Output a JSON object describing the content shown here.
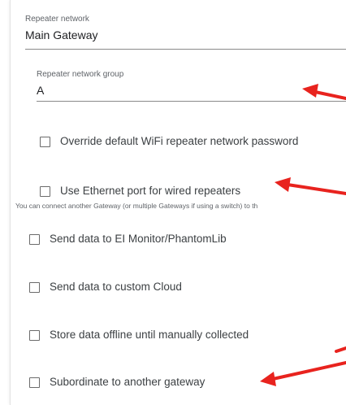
{
  "repeater_network": {
    "label": "Repeater network",
    "value": "Main Gateway"
  },
  "repeater_network_group": {
    "label": "Repeater network group",
    "value": "A"
  },
  "options": {
    "override_password": {
      "label": "Override default WiFi repeater network password",
      "checked": false
    },
    "use_ethernet": {
      "label": "Use Ethernet port for wired repeaters",
      "checked": false
    },
    "ethernet_hint": "You can connect another Gateway (or multiple Gateways if using a switch) to th",
    "send_ei_monitor": {
      "label": "Send data to EI Monitor/PhantomLib",
      "checked": false
    },
    "send_custom_cloud": {
      "label": "Send data to custom Cloud",
      "checked": false
    },
    "store_offline": {
      "label": "Store data offline until manually collected",
      "checked": false
    },
    "subordinate": {
      "label": "Subordinate to another gateway",
      "checked": false
    }
  },
  "annotations": {
    "arrow_color": "#e8231e",
    "arrow_count": 4
  }
}
